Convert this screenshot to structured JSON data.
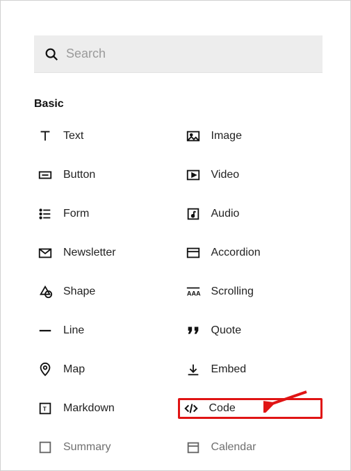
{
  "search": {
    "placeholder": "Search",
    "value": ""
  },
  "section": {
    "title": "Basic"
  },
  "items": [
    {
      "label": "Text",
      "icon": "text-icon"
    },
    {
      "label": "Image",
      "icon": "image-icon"
    },
    {
      "label": "Button",
      "icon": "button-icon"
    },
    {
      "label": "Video",
      "icon": "video-icon"
    },
    {
      "label": "Form",
      "icon": "form-icon"
    },
    {
      "label": "Audio",
      "icon": "audio-icon"
    },
    {
      "label": "Newsletter",
      "icon": "newsletter-icon"
    },
    {
      "label": "Accordion",
      "icon": "accordion-icon"
    },
    {
      "label": "Shape",
      "icon": "shape-icon"
    },
    {
      "label": "Scrolling",
      "icon": "scrolling-icon"
    },
    {
      "label": "Line",
      "icon": "line-icon"
    },
    {
      "label": "Quote",
      "icon": "quote-icon"
    },
    {
      "label": "Map",
      "icon": "map-icon"
    },
    {
      "label": "Embed",
      "icon": "embed-icon"
    },
    {
      "label": "Markdown",
      "icon": "markdown-icon"
    },
    {
      "label": "Code",
      "icon": "code-icon",
      "highlighted": true
    },
    {
      "label": "Summary",
      "icon": "summary-icon"
    },
    {
      "label": "Calendar",
      "icon": "calendar-icon"
    }
  ],
  "annotation": {
    "highlight_color": "#e01414",
    "arrow_color": "#e01414"
  }
}
